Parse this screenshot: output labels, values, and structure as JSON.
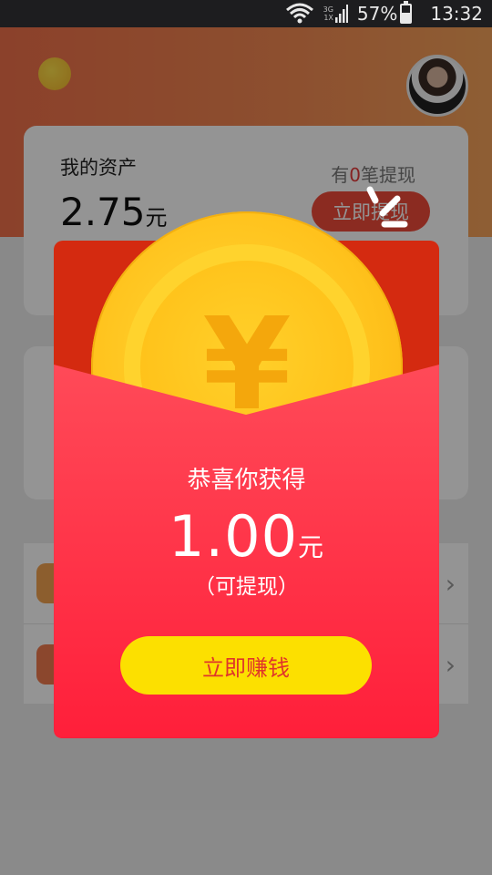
{
  "status_bar": {
    "network_top": "3G",
    "network_bottom": "1X",
    "battery": "57%",
    "time": "13:32",
    "battery_level": 0.57
  },
  "assets": {
    "title": "我的资产",
    "amount": "2.75",
    "unit": "元",
    "withdraw_prefix": "有",
    "withdraw_count": "0",
    "withdraw_suffix": "笔提现",
    "withdraw_button": "立即提现"
  },
  "dialog": {
    "coin_symbol": "¥",
    "title": "恭喜你获得",
    "amount": "1.00",
    "unit": "元",
    "note": "（可提现）",
    "button": "立即赚钱"
  },
  "icons": [
    "wifi-icon",
    "signal-icon",
    "battery-icon",
    "avatar",
    "close-icon",
    "chevron-right-icon"
  ],
  "colors": {
    "packet_red": "#ff2d46",
    "packet_dark": "#d42a10",
    "coin_gold": "#ffc21c",
    "button_yellow": "#fce000",
    "button_text": "#e0352a"
  }
}
